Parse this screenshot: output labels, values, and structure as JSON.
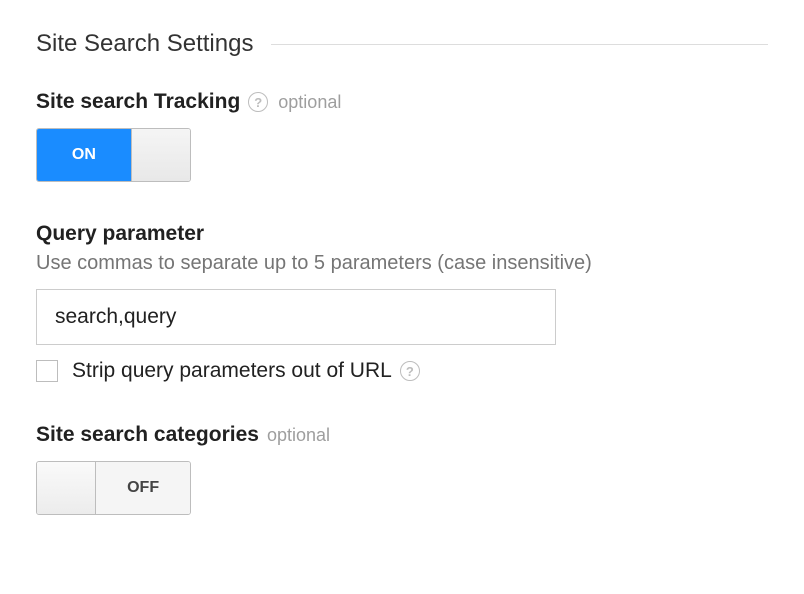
{
  "section": {
    "title": "Site Search Settings"
  },
  "tracking": {
    "label": "Site search Tracking",
    "optional": "optional",
    "toggle_state": "ON"
  },
  "query": {
    "label": "Query parameter",
    "help_text": "Use commas to separate up to 5 parameters (case insensitive)",
    "value": "search,query",
    "strip_label": "Strip query parameters out of URL",
    "strip_checked": false
  },
  "categories": {
    "label": "Site search categories",
    "optional": "optional",
    "toggle_state": "OFF"
  }
}
